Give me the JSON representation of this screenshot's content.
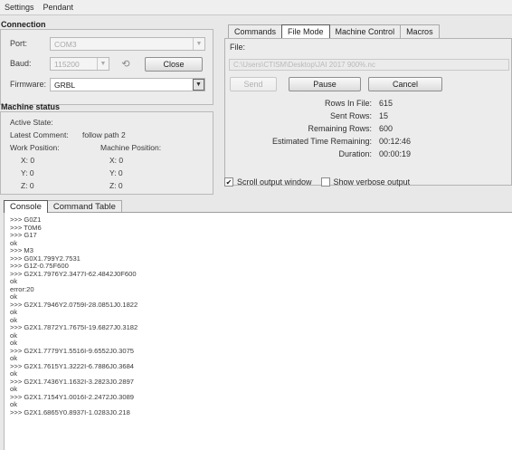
{
  "menu": [
    "Settings",
    "Pendant"
  ],
  "connection": {
    "title": "Connection",
    "port_label": "Port:",
    "port_value": "COM3",
    "baud_label": "Baud:",
    "baud_value": "115200",
    "refresh_icon": "refresh-icon",
    "close_label": "Close",
    "firmware_label": "Firmware:",
    "firmware_value": "GRBL"
  },
  "machine_status": {
    "title": "Machine status",
    "active_state_label": "Active State:",
    "latest_comment_label": "Latest Comment:",
    "latest_comment_value": "follow path 2",
    "work_position_label": "Work Position:",
    "machine_position_label": "Machine Position:",
    "work": {
      "x": "X: 0",
      "y": "Y: 0",
      "z": "Z: 0"
    },
    "machine": {
      "x": "X: 0",
      "y": "Y: 0",
      "z": "Z: 0"
    }
  },
  "tabs": [
    "Commands",
    "File Mode",
    "Machine Control",
    "Macros"
  ],
  "active_tab": "File Mode",
  "file_mode": {
    "file_label": "File:",
    "file_path": "C:\\Users\\CTISM\\Desktop\\JAI 2017 900%.nc",
    "send_label": "Send",
    "pause_label": "Pause",
    "cancel_label": "Cancel",
    "rows_in_file_label": "Rows In File:",
    "rows_in_file": "615",
    "sent_rows_label": "Sent Rows:",
    "sent_rows": "15",
    "remaining_rows_label": "Remaining Rows:",
    "remaining_rows": "600",
    "est_time_label": "Estimated Time Remaining:",
    "est_time": "00:12:46",
    "duration_label": "Duration:",
    "duration": "00:00:19"
  },
  "options": {
    "scroll_output_label": "Scroll output window",
    "scroll_output_checked": true,
    "verbose_label": "Show verbose output",
    "verbose_checked": false
  },
  "bottom_tabs": [
    "Console",
    "Command Table"
  ],
  "console_lines": [
    ">>> G0Z1",
    ">>> T0M6",
    ">>> G17",
    "ok",
    ">>> M3",
    ">>> G0X1.799Y2.7531",
    ">>> G1Z-0.75F600",
    ">>> G2X1.7976Y2.3477I-62.4842J0F600",
    "ok",
    "error:20",
    "ok",
    ">>> G2X1.7946Y2.0759I-28.0851J0.1822",
    "ok",
    "ok",
    ">>> G2X1.7872Y1.7675I-19.6827J0.3182",
    "ok",
    "ok",
    ">>> G2X1.7779Y1.5516I-9.6552J0.3075",
    "ok",
    ">>> G2X1.7615Y1.3222I-6.7886J0.3684",
    "ok",
    ">>> G2X1.7436Y1.1632I-3.2823J0.2897",
    "ok",
    ">>> G2X1.7154Y1.0016I-2.2472J0.3089",
    "ok",
    ">>> G2X1.6865Y0.8937I-1.0283J0.218"
  ]
}
